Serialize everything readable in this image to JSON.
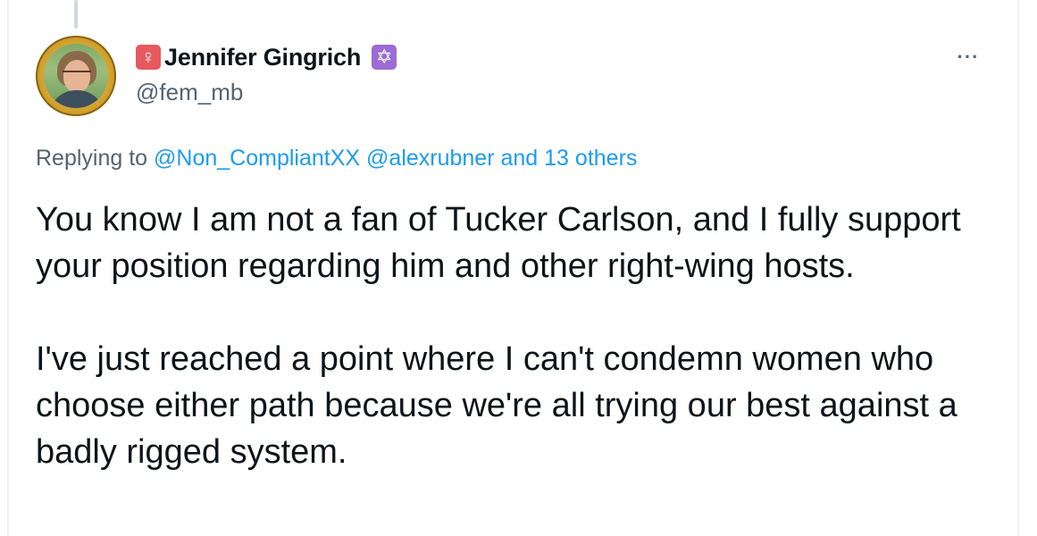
{
  "author": {
    "female_badge_glyph": "♀",
    "display_name": "Jennifer Gingrich",
    "star_badge_glyph": "✡",
    "handle": "@fem_mb",
    "avatar_icon": "profile-photo"
  },
  "menu": {
    "more_glyph": "···"
  },
  "reply": {
    "prefix": "Replying to",
    "mention_1": "@Non_CompliantXX",
    "mention_2": "@alexrubner",
    "and_others": "and 13 others"
  },
  "tweet": {
    "paragraph_1": "You know I am not a fan of Tucker Carlson, and I fully support your position regarding him and other right-wing hosts.",
    "paragraph_2": "I've just reached a point where I can't condemn women who choose either path because we're all trying our best against a badly rigged system."
  },
  "colors": {
    "text_primary": "#0f1419",
    "text_secondary": "#536471",
    "link": "#1d9bf0",
    "female_badge": "#e7595f",
    "star_badge": "#9c6bd3"
  }
}
